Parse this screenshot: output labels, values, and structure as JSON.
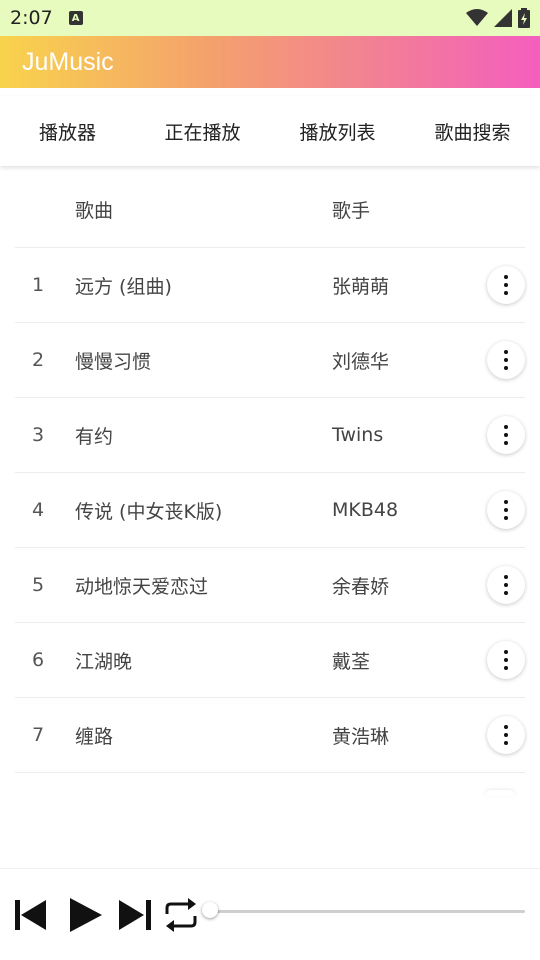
{
  "status_bar": {
    "time": "2:07",
    "notification_letter": "A"
  },
  "app_bar": {
    "title": "JuMusic",
    "gradient": [
      "#f8d34c",
      "#f4a06e",
      "#f27a9c",
      "#f45ebe"
    ]
  },
  "tabs": [
    {
      "label": "播放器"
    },
    {
      "label": "正在播放"
    },
    {
      "label": "播放列表"
    },
    {
      "label": "歌曲搜索"
    }
  ],
  "table": {
    "headers": {
      "song": "歌曲",
      "artist": "歌手"
    },
    "rows": [
      {
        "num": "1",
        "song": "远方 (组曲)",
        "artist": "张萌萌"
      },
      {
        "num": "2",
        "song": "慢慢习惯",
        "artist": "刘德华"
      },
      {
        "num": "3",
        "song": "有约",
        "artist": "Twins"
      },
      {
        "num": "4",
        "song": "传说 (中女丧K版)",
        "artist": "MKB48"
      },
      {
        "num": "5",
        "song": "动地惊天爱恋过",
        "artist": "余春娇"
      },
      {
        "num": "6",
        "song": "江湖晚",
        "artist": "戴荃"
      },
      {
        "num": "7",
        "song": "缠路",
        "artist": "黄浩琳"
      }
    ]
  },
  "player": {
    "progress": 0
  }
}
